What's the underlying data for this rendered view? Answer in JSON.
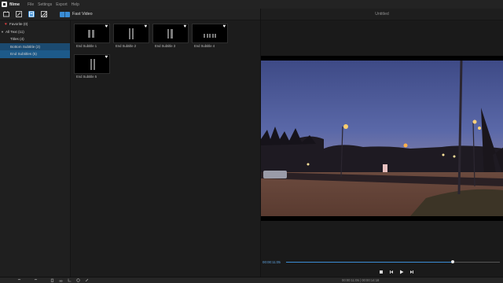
{
  "app": {
    "name": "filme"
  },
  "menu": [
    "File",
    "Settings",
    "Export",
    "Help"
  ],
  "toolbar": {
    "icons": [
      "media-icon",
      "text-icon",
      "transition-icon",
      "filter-icon"
    ],
    "fast_video_label": "Fast Video"
  },
  "tree": {
    "items": [
      {
        "label": "Favorite (0)",
        "icon": "heart-icon"
      },
      {
        "label": "All Text (11)",
        "icon": "caret-down-icon"
      },
      {
        "label": "Titles (4)"
      },
      {
        "label": "Bottom Subtitle (2)"
      },
      {
        "label": "End Subtitles (5)"
      }
    ]
  },
  "thumbnails": [
    {
      "label": "End Subtitle 1"
    },
    {
      "label": "End Subtitle 2"
    },
    {
      "label": "End Subtitle 3"
    },
    {
      "label": "End Subtitle 4"
    },
    {
      "label": "End Subtitle 5"
    }
  ],
  "preview": {
    "title": "Untitled",
    "timecode": "00:00:11:05",
    "progress": 0.78
  },
  "bottom": {
    "time_readout": "00:00:11:05 | 00:00:14:18"
  },
  "colors": {
    "accent": "#3a8dd6",
    "selection": "#1d5a89",
    "favorite": "#e04040"
  }
}
